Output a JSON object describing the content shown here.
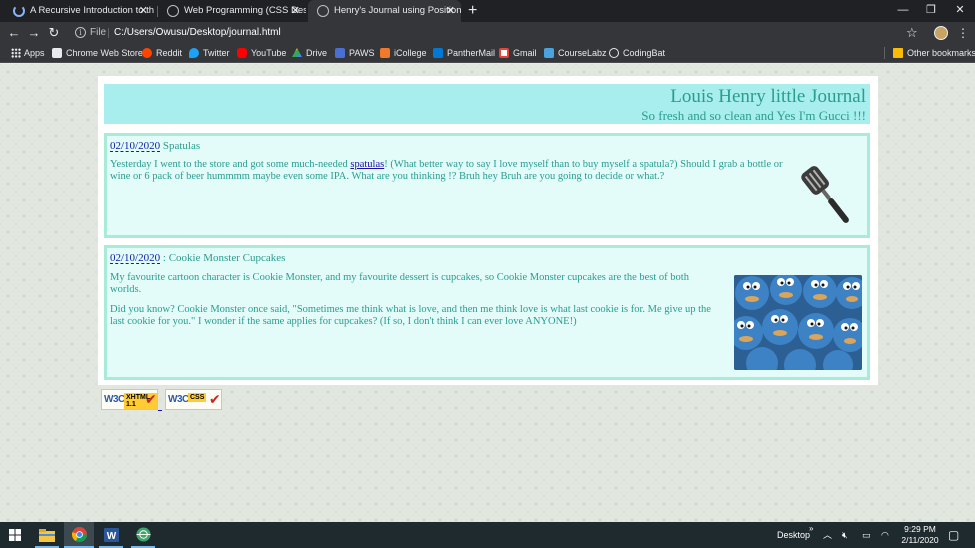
{
  "browser": {
    "tabs": [
      {
        "title": "A Recursive Introduction to the T",
        "favicon": "loading-spinner-icon",
        "active": false
      },
      {
        "title": "Web Programming (CSS Design a",
        "favicon": "globe-icon",
        "active": false
      },
      {
        "title": "Henry's Journal using Positioning",
        "favicon": "globe-icon",
        "active": true
      }
    ],
    "address": {
      "scheme": "File",
      "url": "C:/Users/Owusu/Desktop/journal.html"
    },
    "bookmarks": [
      {
        "label": "Apps",
        "icon": "apps-grid-icon",
        "color": "#e8eaed"
      },
      {
        "label": "Chrome Web Store",
        "icon": "chrome-web-store-icon",
        "color": "#e8eaed"
      },
      {
        "label": "Reddit",
        "icon": "reddit-icon",
        "color": "#ff4500"
      },
      {
        "label": "Twitter",
        "icon": "twitter-icon",
        "color": "#1da1f2"
      },
      {
        "label": "YouTube",
        "icon": "youtube-icon",
        "color": "#ff0000"
      },
      {
        "label": "Drive",
        "icon": "drive-icon",
        "color": "#fbbc04"
      },
      {
        "label": "PAWS",
        "icon": "paws-icon",
        "color": "#4a6fd3"
      },
      {
        "label": "iCollege",
        "icon": "icollege-icon",
        "color": "#f07a2a"
      },
      {
        "label": "PantherMail",
        "icon": "outlook-icon",
        "color": "#0078d4"
      },
      {
        "label": "Gmail",
        "icon": "gmail-icon",
        "color": "#ea4335"
      },
      {
        "label": "CourseLabz",
        "icon": "courselabz-icon",
        "color": "#4aa3df"
      },
      {
        "label": "CodingBat",
        "icon": "globe-icon",
        "color": "#e8eaed"
      }
    ],
    "other_bookmarks": "Other bookmarks"
  },
  "journal": {
    "title": "Louis Henry little Journal",
    "subtitle": "So fresh and so clean and Yes I'm Gucci !!!",
    "entries": [
      {
        "date": "02/10/2020",
        "sep": " ",
        "title": "Spatulas",
        "p1_before": "Yesterday I went to the store and got some much-needed ",
        "p1_link": "spatulas",
        "p1_after": "! (What better way to say I love myself than to buy myself a spatula?) Should I grab a bottle or wine or 6 pack of beer hummmm maybe even some IPA. What are you thinking !? Bruh hey Bruh are you going to decide or what.?"
      },
      {
        "date": "02/10/2020",
        "sep": " : ",
        "title": "Cookie Monster Cupcakes",
        "p1": "My favourite cartoon character is Cookie Monster, and my favourite dessert is cupcakes, so Cookie Monster cupcakes are the best of both worlds.",
        "p2": "Did you know? Cookie Monster once said, \"Sometimes me think what is love, and then me think love is what last cookie is for. Me give up the last cookie for you.\" I wonder if the same applies for cupcakes? (If so, I don't think I can ever love ANYONE!)"
      }
    ],
    "badges": [
      {
        "w3c": "W3C",
        "tag": "XHTML 1.1"
      },
      {
        "w3c": "W3C",
        "tag": "CSS"
      }
    ]
  },
  "taskbar": {
    "desktop_label": "Desktop",
    "time": "9:29 PM",
    "date": "2/11/2020"
  }
}
